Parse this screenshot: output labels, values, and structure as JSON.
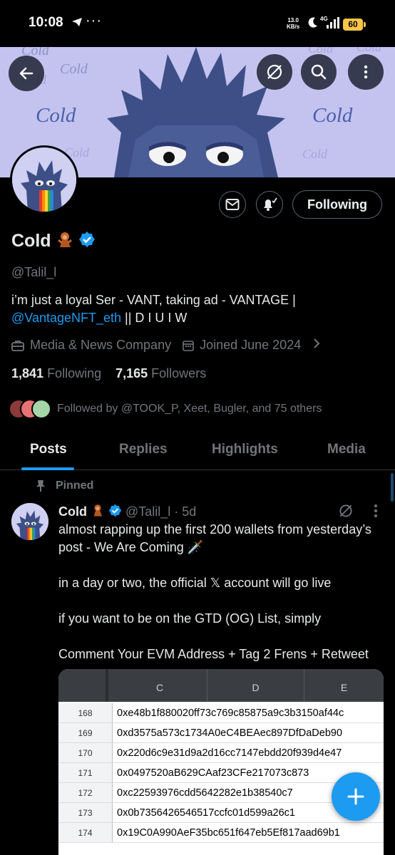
{
  "status_bar": {
    "time": "10:08",
    "more": "···",
    "net_speed_value": "13.0",
    "net_speed_unit": "KB/s",
    "network": "4G",
    "battery": "60"
  },
  "banner": {
    "word": "Cold"
  },
  "profile": {
    "display_name": "Cold",
    "handle": "@Talil_l",
    "bio_text": "i’m just a loyal Ser - VANT, taking ad - VANTAGE |",
    "bio_link": "@VantageNFT_eth",
    "bio_suffix": " || D I U I W",
    "category": "Media & News Company",
    "joined": "Joined June 2024",
    "following_count": "1,841",
    "following_label": "Following",
    "followers_count": "7,165",
    "followers_label": "Followers",
    "followed_by": "Followed by @TOOK_P, Xeet, Bugler, and 75 others",
    "following_button": "Following"
  },
  "tabs": [
    "Posts",
    "Replies",
    "Highlights",
    "Media"
  ],
  "tweet": {
    "pinned_label": "Pinned",
    "name": "Cold",
    "handle_time": "@Talil_l · 5d",
    "paragraphs": [
      "almost rapping up the first 200 wallets from yesterday’s post - We Are Coming 🗡️",
      "in a day or two, the official 𝕏 account will go live",
      "if you want to be on the GTD (OG) List, simply",
      "Comment Your EVM Address + Tag 2 Frens + Retweet"
    ],
    "sheet": {
      "columns": [
        "C",
        "D",
        "E"
      ],
      "rows": [
        {
          "num": "168",
          "value": "0xe48b1f880020ff73c769c85875a9c3b3150af44c"
        },
        {
          "num": "169",
          "value": "0xd3575a573c1734A0eC4BEAec897DfDaDeb90"
        },
        {
          "num": "170",
          "value": "0x220d6c9e31d9a2d16cc7147ebdd20f939d4e47"
        },
        {
          "num": "171",
          "value": "0x0497520aB629CAaf23CFe217073c873"
        },
        {
          "num": "172",
          "value": "0xc22593976cdd5642282e1b38540c7"
        },
        {
          "num": "173",
          "value": "0x0b7356426546517ccfc01d599a26c1"
        },
        {
          "num": "174",
          "value": "0x19C0A990AeF35bc651f647eb5Ef817aad69b1"
        }
      ]
    }
  },
  "colors": {
    "accent": "#1d9bf0",
    "banner_bg": "#c4c3f0",
    "muted": "#71767b"
  }
}
